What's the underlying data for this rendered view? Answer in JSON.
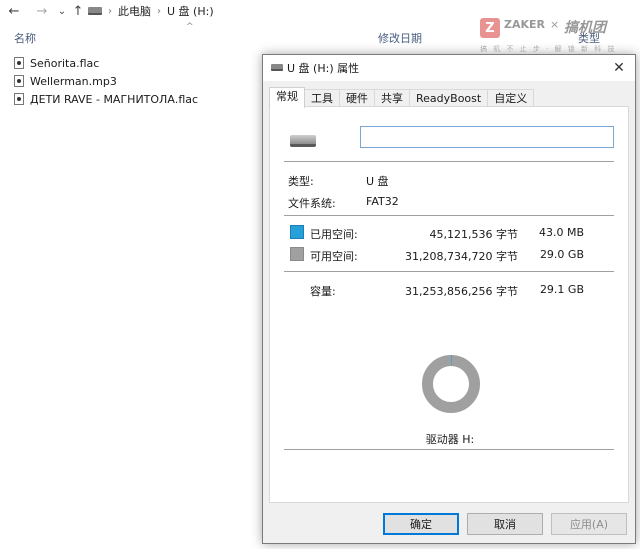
{
  "explorer": {
    "nav": {
      "back": "←",
      "forward": "→",
      "recent": "⌄",
      "up": "↑"
    },
    "breadcrumb": [
      "此电脑",
      "U 盘 (H:)"
    ],
    "columns": {
      "name": "名称",
      "modified": "修改日期",
      "type": "类型"
    },
    "files": [
      {
        "name": "Señorita.flac"
      },
      {
        "name": "Wellerman.mp3"
      },
      {
        "name": "ДЕТИ RAVE - МАГНИТОЛА.flac"
      }
    ]
  },
  "watermark": {
    "mark": "Z",
    "zaker": "ZAKER",
    "x": "×",
    "brand": "搞机团",
    "sub": "搞 机 不 止 步 · 解 锁 新 科 技"
  },
  "dialog": {
    "title": "U 盘 (H:) 属性",
    "close": "✕",
    "tabs": [
      "常规",
      "工具",
      "硬件",
      "共享",
      "ReadyBoost",
      "自定义"
    ],
    "volume_name": "",
    "type_label": "类型:",
    "type_value": "U 盘",
    "fs_label": "文件系统:",
    "fs_value": "FAT32",
    "used": {
      "label": "已用空间:",
      "bytes": "45,121,536 字节",
      "size": "43.0 MB",
      "color": "#26a0da"
    },
    "free": {
      "label": "可用空间:",
      "bytes": "31,208,734,720 字节",
      "size": "29.0 GB",
      "color": "#a0a0a0"
    },
    "capacity": {
      "label": "容量:",
      "bytes": "31,253,856,256 字节",
      "size": "29.1 GB"
    },
    "used_fraction": 0.00144,
    "drive_label": "驱动器 H:",
    "buttons": {
      "ok": "确定",
      "cancel": "取消",
      "apply": "应用(A)"
    }
  }
}
